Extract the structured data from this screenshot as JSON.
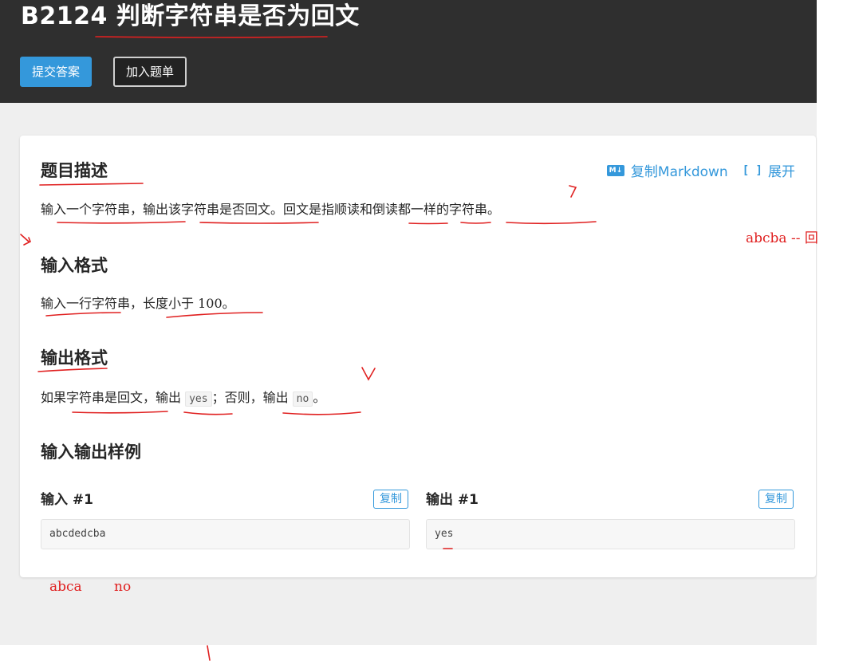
{
  "header": {
    "title": "B2124 判断字符串是否为回文",
    "submit_label": "提交答案",
    "add_label": "加入题单"
  },
  "toolbar": {
    "copy_markdown": "复制Markdown",
    "expand": "展开",
    "md_icon_text": "M↓"
  },
  "sections": {
    "description_title": "题目描述",
    "description_text": "输入一个字符串，输出该字符串是否回文。回文是指顺读和倒读都一样的字符串。",
    "input_title": "输入格式",
    "input_text_pre": "输入一行字符串，长度小于 ",
    "input_text_num": "100",
    "input_text_post": "。",
    "output_title": "输出格式",
    "output_text_1": "如果字符串是回文，输出 ",
    "output_code_yes": "yes",
    "output_text_2": "；否则，输出 ",
    "output_code_no": "no",
    "output_text_3": "。",
    "samples_title": "输入输出样例"
  },
  "samples": [
    {
      "input_label": "输入 #1",
      "input_value": "abcdedcba",
      "output_label": "输出 #1",
      "output_value": "yes",
      "copy_label": "复制"
    }
  ],
  "annotations": {
    "note_right": "abcba -- 回",
    "note_bottom_1": "abca",
    "note_bottom_2": "no"
  },
  "colors": {
    "header_bg": "#2f2f2f",
    "accent": "#3498db",
    "ink": "#e02020",
    "page_bg": "#efefef"
  }
}
